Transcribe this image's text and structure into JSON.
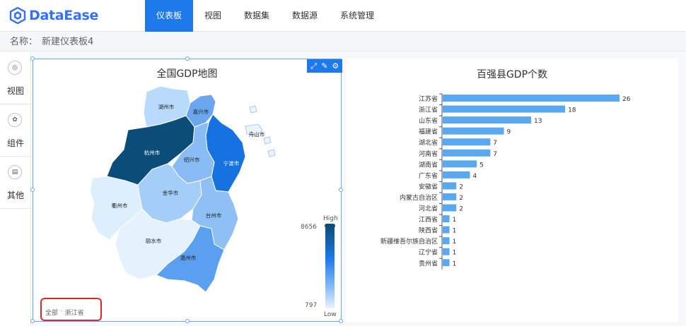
{
  "app": {
    "name": "DataEase"
  },
  "nav": {
    "items": [
      {
        "label": "仪表板",
        "active": true
      },
      {
        "label": "视图",
        "active": false
      },
      {
        "label": "数据集",
        "active": false
      },
      {
        "label": "数据源",
        "active": false
      },
      {
        "label": "系统管理",
        "active": false
      }
    ]
  },
  "namebar": {
    "label": "名称：",
    "value": "新建仪表板4"
  },
  "sidebar": {
    "items": [
      {
        "label": "视图",
        "icon": "view-icon"
      },
      {
        "label": "组件",
        "icon": "component-icon"
      },
      {
        "label": "其他",
        "icon": "other-icon"
      }
    ]
  },
  "colors": {
    "accent": "#1e79ea",
    "brand": "#3370ff",
    "bar": "#5aa9f0",
    "highlight": "#e4262a"
  },
  "map_panel": {
    "title": "全国GDP地图",
    "regions": [
      {
        "name": "湖州市",
        "color": "#b9dbfb"
      },
      {
        "name": "嘉兴市",
        "color": "#6aa7ef"
      },
      {
        "name": "舟山市",
        "color": "#eaf3fe"
      },
      {
        "name": "杭州市",
        "color": "#0b4d78"
      },
      {
        "name": "宁波市",
        "color": "#1572e0"
      },
      {
        "name": "绍兴市",
        "color": "#89bcf5"
      },
      {
        "name": "金华市",
        "color": "#a4cdf8"
      },
      {
        "name": "衢州市",
        "color": "#ddeefd"
      },
      {
        "name": "台州市",
        "color": "#8ec0f5"
      },
      {
        "name": "丽水市",
        "color": "#e5f1fd"
      },
      {
        "name": "温州市",
        "color": "#5b9ff0"
      }
    ],
    "legend": {
      "high": "High",
      "low": "Low",
      "max": "8656",
      "min": "797"
    },
    "breadcrumb": [
      "全部",
      "浙江省"
    ]
  },
  "chart_data": {
    "type": "bar",
    "title": "百强县GDP个数",
    "orientation": "horizontal",
    "categories": [
      "江苏省",
      "浙江省",
      "山东省",
      "福建省",
      "湖北省",
      "河南省",
      "湖南省",
      "广东省",
      "安徽省",
      "内蒙古自治区",
      "河北省",
      "江西省",
      "陕西省",
      "新疆维吾尔族自治区",
      "辽宁省",
      "贵州省"
    ],
    "values": [
      26,
      18,
      13,
      9,
      7,
      7,
      5,
      4,
      2,
      2,
      2,
      1,
      1,
      1,
      1,
      1
    ],
    "xlim": [
      0,
      26
    ],
    "grid": false
  }
}
